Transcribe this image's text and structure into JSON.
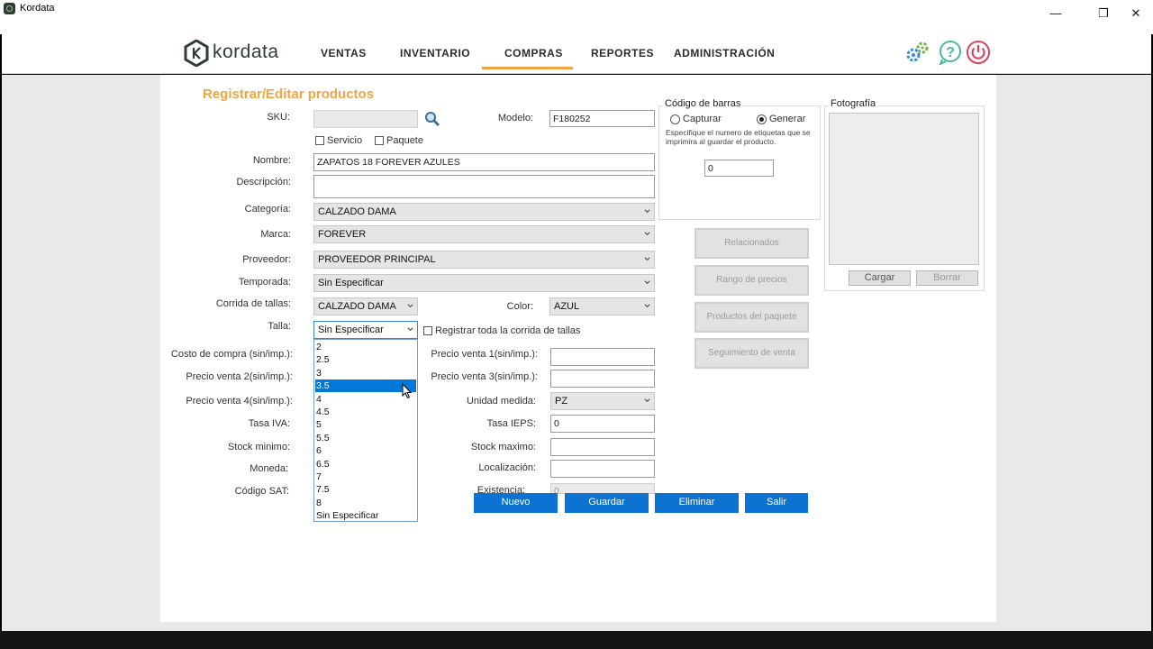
{
  "window": {
    "title": "Kordata",
    "minimize": "—",
    "restore": "❐",
    "close": "✕"
  },
  "brand": {
    "logo_text": "kordata"
  },
  "nav": {
    "items": [
      "VENTAS",
      "INVENTARIO",
      "COMPRAS",
      "REPORTES",
      "ADMINISTRACIÓN"
    ],
    "active": "COMPRAS"
  },
  "header_icons": [
    "settings-gears-icon",
    "help-icon",
    "power-icon"
  ],
  "colors": {
    "accent_orange": "#f0a545",
    "primary_blue": "#0d73d3",
    "selected_blue": "#0078d7"
  },
  "form": {
    "title": "Registrar/Editar productos",
    "labels": {
      "sku": "SKU:",
      "modelo": "Modelo:",
      "nombre": "Nombre:",
      "descripcion": "Descripción:",
      "categoria": "Categoría:",
      "marca": "Marca:",
      "proveedor": "Proveedor:",
      "temporada": "Temporada:",
      "corrida": "Corrida de tallas:",
      "color": "Color:",
      "talla": "Talla:",
      "costo_compra": "Costo de compra (sin/imp.):",
      "precio1": "Precio venta 1(sin/imp.):",
      "precio2": "Precio venta 2(sin/imp.):",
      "precio3": "Precio venta 3(sin/imp.):",
      "precio4": "Precio venta 4(sin/imp.):",
      "unidad": "Unidad medida:",
      "tasa_iva": "Tasa IVA:",
      "tasa_ieps": "Tasa IEPS:",
      "stock_min": "Stock minimo:",
      "stock_max": "Stock maximo:",
      "moneda": "Moneda:",
      "localizacion": "Localización:",
      "codigo_sat": "Código SAT:",
      "existencia": "Existencia:"
    },
    "values": {
      "sku": "",
      "modelo": "F180252",
      "nombre": "ZAPATOS 18 FOREVER AZULES",
      "descripcion": "",
      "categoria": "CALZADO DAMA",
      "marca": "FOREVER",
      "proveedor": "PROVEEDOR PRINCIPAL",
      "temporada": "Sin Especificar",
      "corrida": "CALZADO DAMA",
      "color": "AZUL",
      "talla": "Sin Especificar",
      "precio1": "",
      "precio3": "",
      "unidad": "PZ",
      "tasa_ieps": "0",
      "stock_max": "",
      "localizacion": "",
      "existencia": "0"
    },
    "checkboxes": {
      "servicio": "Servicio",
      "paquete": "Paquete",
      "registrar_corrida": "Registrar toda la corrida de tallas"
    },
    "talla_options": [
      "2",
      "2.5",
      "3",
      "3.5",
      "4",
      "4.5",
      "5",
      "5.5",
      "6",
      "6.5",
      "7",
      "7.5",
      "8",
      "Sin Especificar"
    ],
    "talla_highlighted": "3.5"
  },
  "barcode": {
    "title": "Código de barras",
    "radio_capturar": "Capturar",
    "radio_generar": "Generar",
    "selected": "Generar",
    "hint": "Especifique el numero de etiquetas que se imprimira al guardar el producto.",
    "count": "0"
  },
  "side_buttons": [
    "Relacionados",
    "Rango de precios",
    "Productos del paquete",
    "Seguimiento de venta"
  ],
  "photo": {
    "title": "Fotografía",
    "load": "Cargar",
    "delete": "Borrar"
  },
  "actions": {
    "nuevo": "Nuevo",
    "guardar": "Guardar",
    "eliminar": "Eliminar",
    "salir": "Salir"
  }
}
